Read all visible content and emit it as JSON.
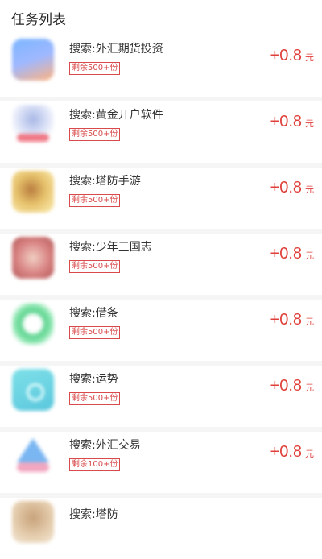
{
  "header": {
    "title": "任务列表"
  },
  "tasks": [
    {
      "title": "搜索:外汇期货投资",
      "badge": "剩余500+份",
      "amount": "+0.8",
      "unit": "元",
      "icon": "blue-chat-app-icon"
    },
    {
      "title": "搜索:黄金开户软件",
      "badge": "剩余500+份",
      "amount": "+0.8",
      "unit": "元",
      "icon": "cartoon-avatar-app-icon"
    },
    {
      "title": "搜索:塔防手游",
      "badge": "剩余500+份",
      "amount": "+0.8",
      "unit": "元",
      "icon": "game-app-icon"
    },
    {
      "title": "搜索:少年三国志",
      "badge": "剩余500+份",
      "amount": "+0.8",
      "unit": "元",
      "icon": "game-app-icon"
    },
    {
      "title": "搜索:借条",
      "badge": "剩余500+份",
      "amount": "+0.8",
      "unit": "元",
      "icon": "green-circle-app-icon"
    },
    {
      "title": "搜索:运势",
      "badge": "剩余500+份",
      "amount": "+0.8",
      "unit": "元",
      "icon": "teal-app-icon"
    },
    {
      "title": "搜索:外汇交易",
      "badge": "剩余100+份",
      "amount": "+0.8",
      "unit": "元",
      "icon": "triangle-app-icon"
    },
    {
      "title": "搜索:塔防",
      "badge": "",
      "amount": "",
      "unit": "",
      "icon": "game-app-icon"
    }
  ]
}
